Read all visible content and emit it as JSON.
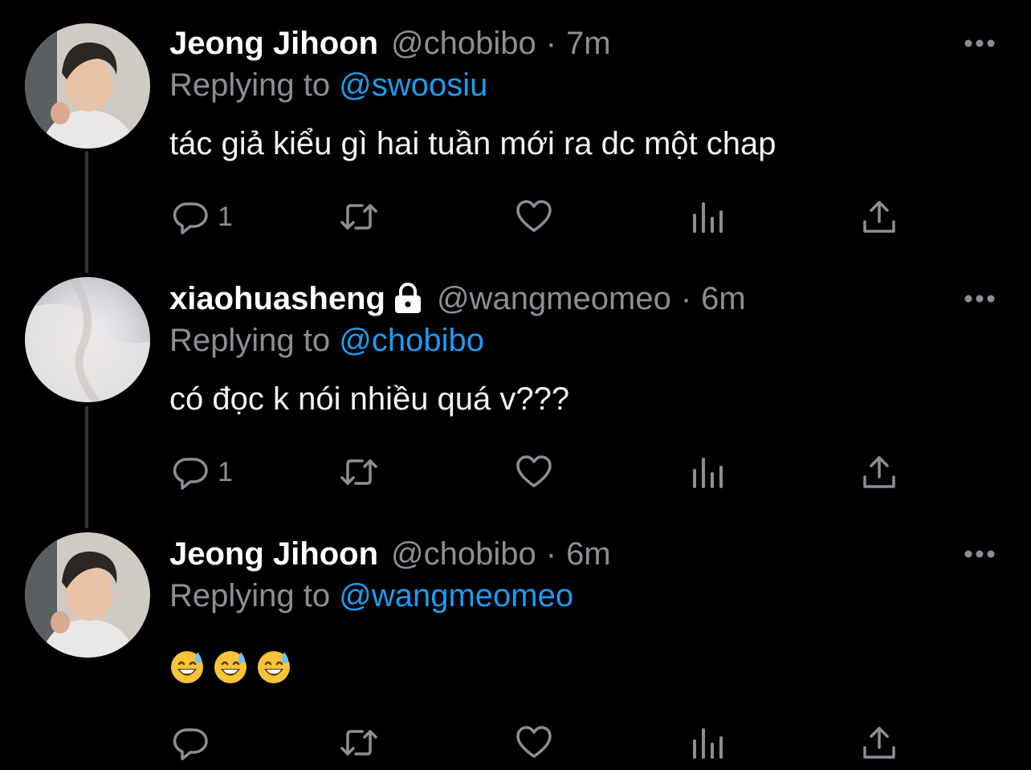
{
  "tweets": [
    {
      "name": "Jeong Jihoon",
      "handle": "@chobibo",
      "separator": "·",
      "time": "7m",
      "replying_prefix": "Replying to",
      "replying_to": "@swoosiu",
      "text": "tác giả kiểu gì hai tuần mới ra dc một chap",
      "reply_count": "1",
      "avatar": "person-photo-avatar",
      "protected": false
    },
    {
      "name": "xiaohuasheng",
      "handle": "@wangmeomeo",
      "separator": "·",
      "time": "6m",
      "replying_prefix": "Replying to",
      "replying_to": "@chobibo",
      "text": "có đọc k nói nhiều quá v???",
      "reply_count": "1",
      "avatar": "blurred-photo-avatar",
      "protected": true
    },
    {
      "name": "Jeong Jihoon",
      "handle": "@chobibo",
      "separator": "·",
      "time": "6m",
      "replying_prefix": "Replying to",
      "replying_to": "@wangmeomeo",
      "emojis": [
        "grinning-face-with-sweat-emoji",
        "grinning-face-with-sweat-emoji",
        "grinning-face-with-sweat-emoji"
      ],
      "reply_count": "",
      "avatar": "person-photo-avatar",
      "protected": false
    }
  ],
  "icons": {
    "reply": "reply-icon",
    "retweet": "retweet-icon",
    "like": "like-icon",
    "analytics": "analytics-icon",
    "share": "share-icon",
    "more": "more-options-icon",
    "lock": "lock-icon"
  },
  "colors": {
    "background": "#000000",
    "name": "#ffffff",
    "muted": "#8b8f94",
    "link": "#1d9bf0",
    "thread_line": "#333639"
  }
}
